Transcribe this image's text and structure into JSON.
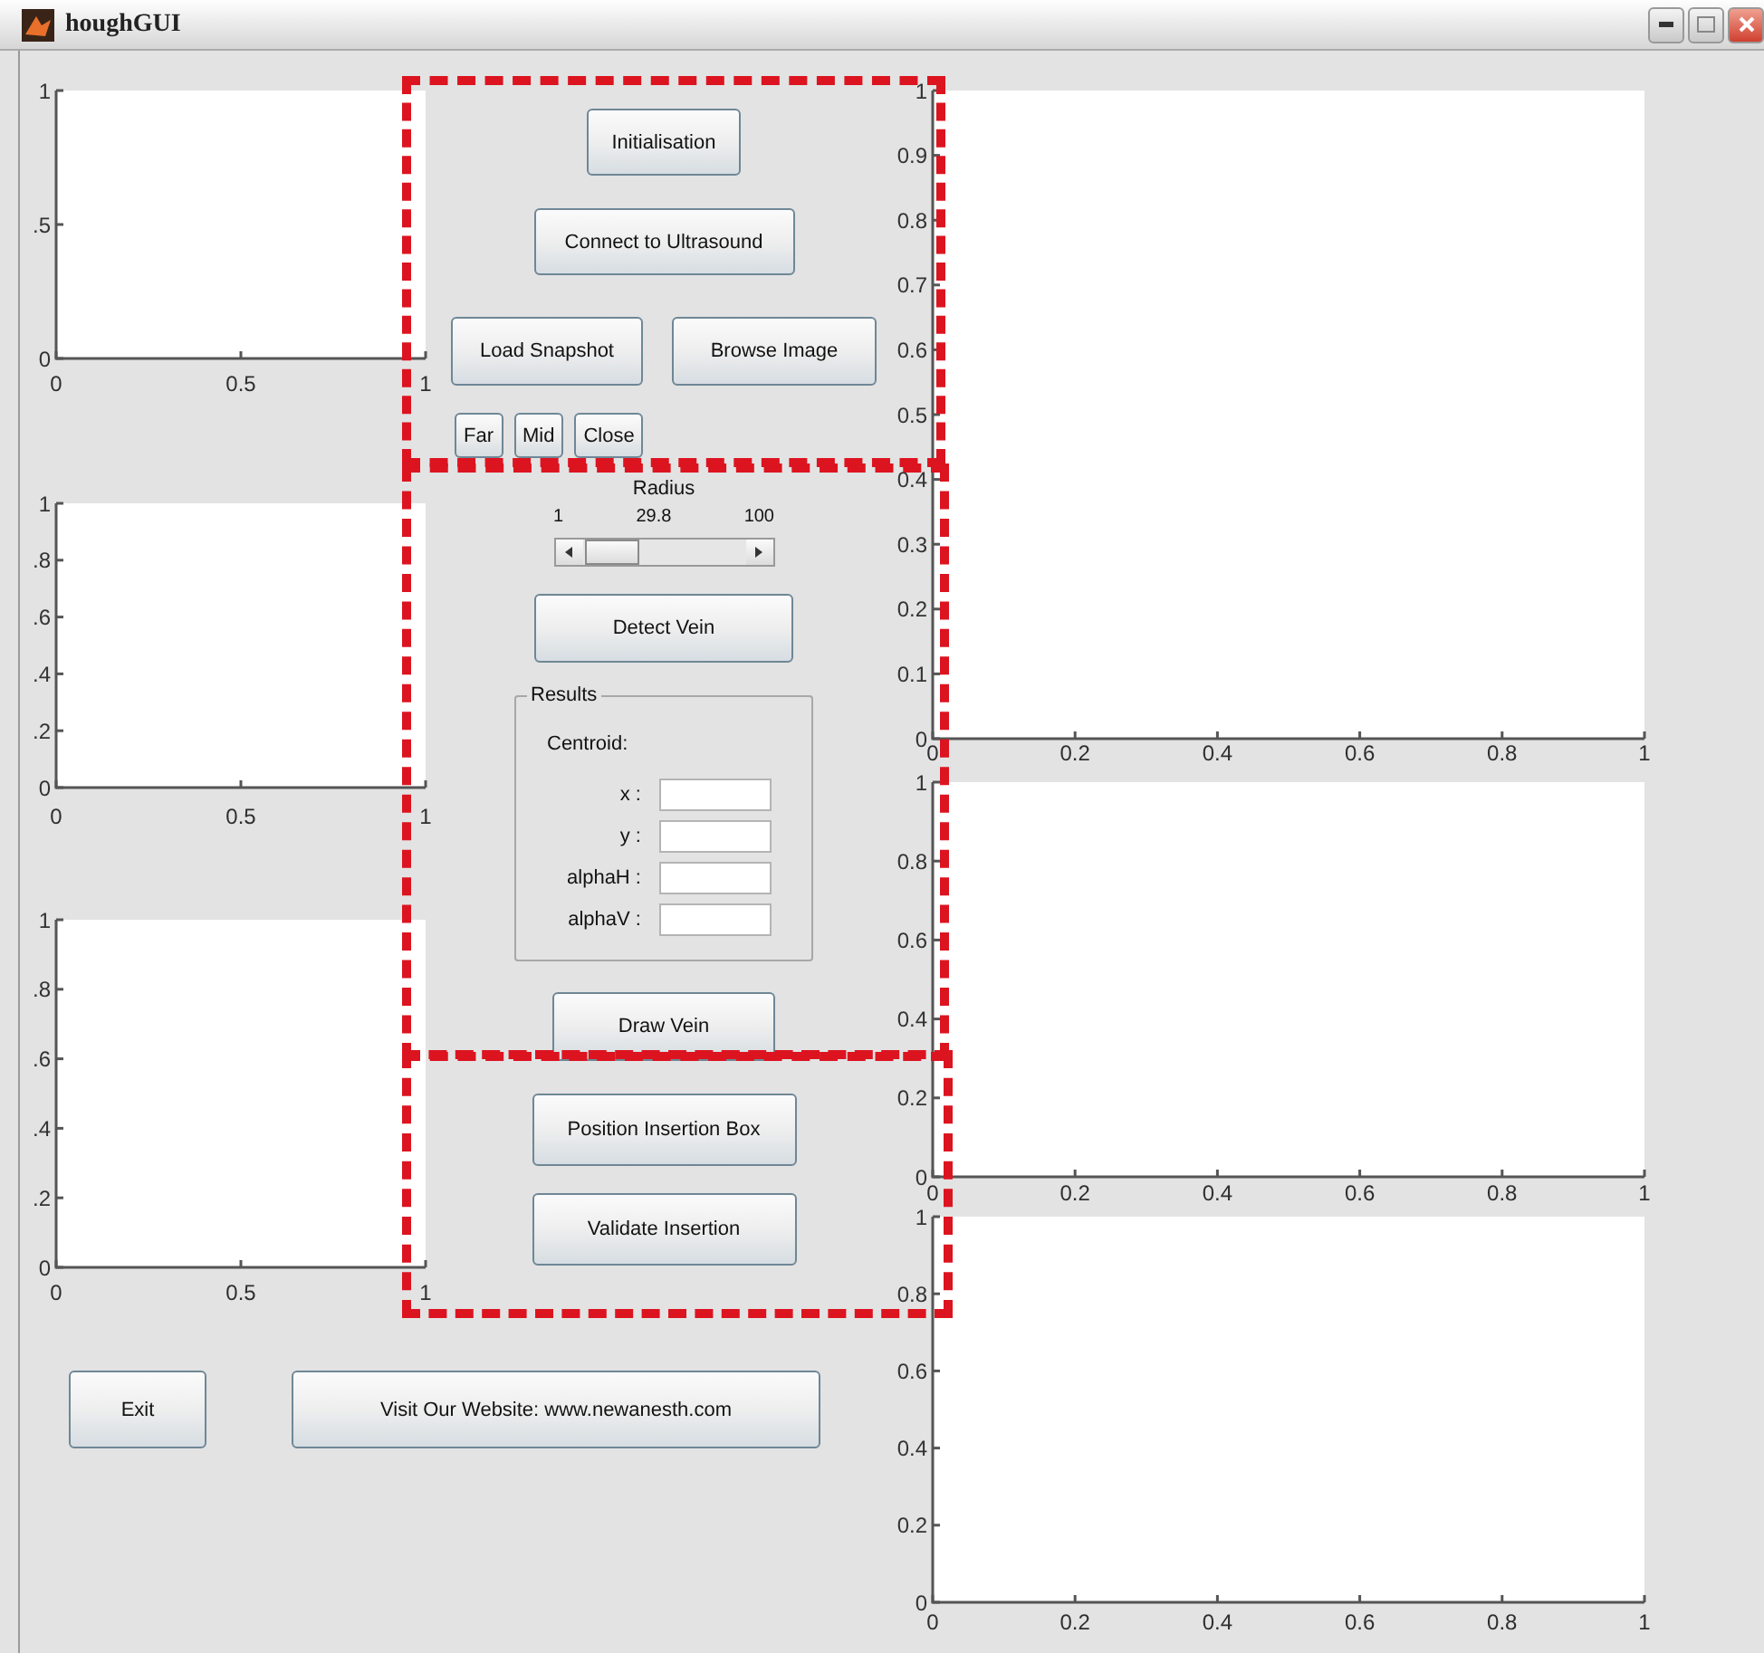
{
  "window": {
    "title": "houghGUI"
  },
  "left_axes": [
    {
      "chart_data": {
        "type": "line",
        "xlim": [
          0,
          1
        ],
        "ylim": [
          0,
          1
        ],
        "xticks": [
          {
            "value": 0,
            "label": "0"
          },
          {
            "value": 0.5,
            "label": "0.5"
          },
          {
            "value": 1,
            "label": "1"
          }
        ],
        "yticks": [
          {
            "value": 0,
            "label": "0"
          },
          {
            "value": 0.5,
            "label": ".5"
          },
          {
            "value": 1,
            "label": "1"
          }
        ]
      }
    },
    {
      "chart_data": {
        "type": "line",
        "xlim": [
          0,
          1
        ],
        "ylim": [
          0,
          1
        ],
        "xticks": [
          {
            "value": 0,
            "label": "0"
          },
          0.5,
          {
            "value": 1,
            "label": "1"
          }
        ],
        "yticks": [
          {
            "value": 0,
            "label": "0"
          },
          {
            "value": 0.2,
            "label": ".2"
          },
          {
            "value": 0.4,
            "label": ".4"
          },
          {
            "value": 0.6,
            "label": ".6"
          },
          {
            "value": 0.8,
            "label": ".8"
          },
          {
            "value": 1,
            "label": "1"
          }
        ]
      }
    },
    {
      "chart_data": {
        "type": "line",
        "xlim": [
          0,
          1
        ],
        "ylim": [
          0,
          1
        ],
        "xticks": [
          {
            "value": 0,
            "label": "0"
          },
          0.5,
          {
            "value": 1,
            "label": "1"
          }
        ],
        "yticks": [
          {
            "value": 0,
            "label": "0"
          },
          {
            "value": 0.2,
            "label": ".2"
          },
          {
            "value": 0.4,
            "label": ".4"
          },
          {
            "value": 0.6,
            "label": ".6"
          },
          {
            "value": 0.8,
            "label": ".8"
          },
          {
            "value": 1,
            "label": "1"
          }
        ]
      }
    }
  ],
  "controls": {
    "setup_buttons": [
      "Initialisation",
      "Connect to Ultrasound"
    ],
    "image_buttons": [
      "Load Snapshot",
      "Browse Image"
    ],
    "range_buttons": [
      "Far",
      "Mid",
      "Close"
    ],
    "radius": {
      "label": "Radius",
      "min": "1",
      "value": "29.8",
      "max": "100",
      "level": 0.03
    },
    "detect_button": "Detect Vein",
    "results": {
      "title": "Results",
      "centroid_label": "Centroid:",
      "fields": [
        {
          "label": "x :"
        },
        {
          "label": "y :"
        },
        {
          "label": "alphaH :"
        },
        {
          "label": "alphaV :"
        }
      ]
    },
    "draw_button": "Draw Vein",
    "insertion_buttons": [
      "Position Insertion Box",
      "Validate Insertion"
    ]
  },
  "right_axes": [
    {
      "chart_data": {
        "type": "line",
        "xlim": [
          0,
          1
        ],
        "ylim": [
          0,
          1
        ],
        "xticks": [
          {
            "value": 0,
            "label": "0"
          },
          {
            "value": 0.2,
            "label": "0.2"
          },
          {
            "value": 0.4,
            "label": "0.4"
          },
          {
            "value": 0.6,
            "label": "0.6"
          },
          {
            "value": 0.8,
            "label": "0.8"
          },
          {
            "value": 1,
            "label": "1"
          }
        ],
        "yticks": [
          {
            "value": 0,
            "label": "0"
          },
          {
            "value": 0.1,
            "label": "0.1"
          },
          {
            "value": 0.2,
            "label": "0.2"
          },
          {
            "value": 0.3,
            "label": "0.3"
          },
          {
            "value": 0.4,
            "label": "0.4"
          },
          {
            "value": 0.5,
            "label": "0.5"
          },
          {
            "value": 0.6,
            "label": "0.6"
          },
          {
            "value": 0.7,
            "label": "0.7"
          },
          {
            "value": 0.8,
            "label": "0.8"
          },
          {
            "value": 0.9,
            "label": "0.9"
          },
          {
            "value": 1,
            "label": "1"
          }
        ]
      }
    },
    {
      "chart_data": {
        "type": "line",
        "xlim": [
          0,
          1
        ],
        "ylim": [
          0,
          1
        ],
        "xticks": [
          {
            "value": 0,
            "label": "0"
          },
          {
            "value": 0.2,
            "label": "0.2"
          },
          {
            "value": 0.4,
            "label": "0.4"
          },
          {
            "value": 0.6,
            "label": "0.6"
          },
          {
            "value": 0.8,
            "label": "0.8"
          },
          {
            "value": 1,
            "label": "1"
          }
        ],
        "yticks": [
          {
            "value": 0,
            "label": "0"
          },
          {
            "value": 0.2,
            "label": "0.2"
          },
          {
            "value": 0.4,
            "label": "0.4"
          },
          {
            "value": 0.6,
            "label": "0.6"
          },
          {
            "value": 0.8,
            "label": "0.8"
          },
          {
            "value": 1,
            "label": "1"
          }
        ]
      }
    },
    {
      "chart_data": {
        "type": "line",
        "xlim": [
          0,
          1
        ],
        "ylim": [
          0,
          1
        ],
        "xticks": [
          {
            "value": 0,
            "label": "0"
          },
          {
            "value": 0.2,
            "label": "0.2"
          },
          {
            "value": 0.4,
            "label": "0.4"
          },
          {
            "value": 0.6,
            "label": "0.6"
          },
          {
            "value": 0.8,
            "label": "0.8"
          },
          {
            "value": 1,
            "label": "1"
          }
        ],
        "yticks": [
          {
            "value": 0,
            "label": "0"
          },
          {
            "value": 0.2,
            "label": "0.2"
          },
          {
            "value": 0.4,
            "label": "0.4"
          },
          {
            "value": 0.6,
            "label": "0.6"
          },
          {
            "value": 0.8,
            "label": "0.8"
          },
          {
            "value": 1,
            "label": "1"
          }
        ]
      }
    }
  ],
  "bottom_buttons": [
    "Exit",
    "Visit Our Website: www.newanesth.com"
  ]
}
